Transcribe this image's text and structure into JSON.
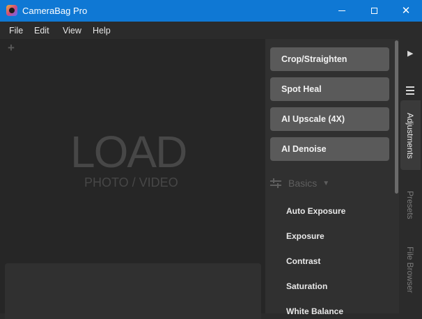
{
  "window": {
    "title": "CameraBag Pro"
  },
  "menu": {
    "items": [
      "File",
      "Edit",
      "View",
      "Help"
    ]
  },
  "canvas": {
    "load_big": "LOAD",
    "load_small": "PHOTO / VIDEO",
    "add_symbol": "+"
  },
  "tools": [
    "Crop/Straighten",
    "Spot Heal",
    "AI Upscale (4X)",
    "AI Denoise"
  ],
  "section": {
    "title": "Basics",
    "items": [
      "Auto Exposure",
      "Exposure",
      "Contrast",
      "Saturation",
      "White Balance"
    ]
  },
  "sidetabs": [
    "Adjustments",
    "Presets",
    "File Browser"
  ],
  "colors": {
    "titlebar": "#0f78d4",
    "background": "#2b2b2b",
    "button": "#5a5a5a",
    "load_text": "#474747"
  },
  "icons": {
    "app": "camerabag-logo-icon",
    "minimize": "minimize-icon",
    "maximize": "maximize-icon",
    "close": "close-icon",
    "add": "plus-icon",
    "collapse": "play-arrow-icon",
    "menu": "hamburger-icon",
    "sliders": "sliders-icon",
    "caret": "caret-down-icon"
  }
}
